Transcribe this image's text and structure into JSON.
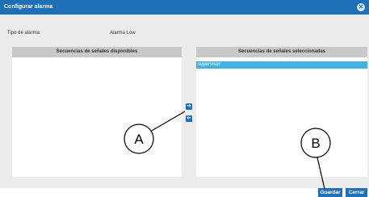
{
  "dialog": {
    "title": "Configurar alarma",
    "close_icon": "close-circle-icon"
  },
  "alarm_type": {
    "label": "Tipo de alarma:",
    "value": "Alarma Low"
  },
  "available_panel": {
    "header": "Secuencias de señales disponibles",
    "items": []
  },
  "selected_panel": {
    "header": "Secuencias de señales seleccionadas",
    "items": [
      "supervisor"
    ]
  },
  "move_buttons": {
    "add_icon": "arrow-right-icon",
    "remove_icon": "arrow-left-icon"
  },
  "footer": {
    "save_label": "Guardar",
    "close_label": "Cerrar"
  },
  "callouts": {
    "a": "A",
    "b": "B"
  },
  "colors": {
    "accent": "#1f6fb7",
    "selection": "#45b2dd",
    "panel_header": "#c9c9c9",
    "background": "#ececec"
  }
}
